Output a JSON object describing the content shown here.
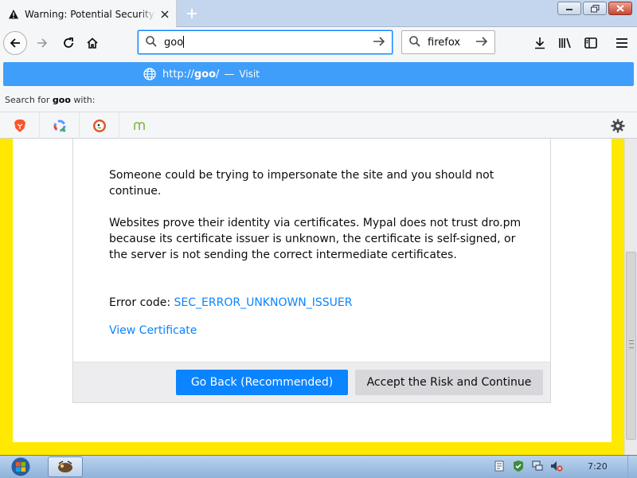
{
  "tab": {
    "title": "Warning: Potential Security Risk Ahead",
    "close_icon": "close-icon",
    "warning_icon": "warning-icon"
  },
  "toolbar": {
    "url_value": "goo",
    "search_engine_placeholder": "firefox"
  },
  "dropdown": {
    "suggestion_url_prefix": "http://",
    "suggestion_url_host": "goo",
    "suggestion_url_suffix": "/",
    "suggestion_separator": "—",
    "suggestion_action": "Visit",
    "search_for_prefix": "Search for",
    "search_for_term": "goo",
    "search_for_suffix": "with:",
    "engines": [
      "brave-icon",
      "qwant-icon",
      "duckduckgo-icon",
      "mojeek-icon"
    ]
  },
  "page": {
    "para1": "Someone could be trying to impersonate the site and you should not continue.",
    "para2": "Websites prove their identity via certificates. Mypal does not trust dro.pm because its certificate issuer is unknown, the certificate is self-signed, or the server is not sending the correct intermediate certificates.",
    "error_label": "Error code:",
    "error_code": "SEC_ERROR_UNKNOWN_ISSUER",
    "view_certificate": "View Certificate",
    "go_back": "Go Back (Recommended)",
    "accept": "Accept the Risk and Continue"
  },
  "taskbar": {
    "clock": "7:20"
  },
  "colors": {
    "accent": "#0a84ff",
    "suggestion_bg": "#3f9ef9",
    "frame": "#ffe900"
  }
}
